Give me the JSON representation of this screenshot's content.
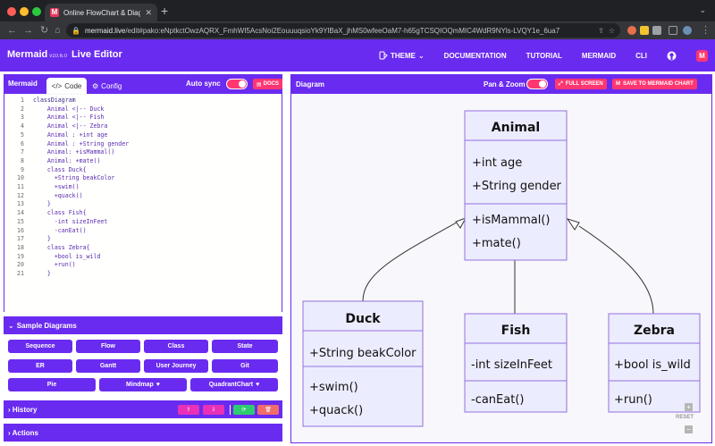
{
  "browser": {
    "tab_title": "Online FlowChart & Diagrams",
    "url_host": "mermaid.live",
    "url_path": "/edit#pako:eNptkctOwzAQRX_FmhWI5AcsNoi2EouuuqsioYk9YlBaX_jhMS0wfeeOaM7-h65gTCSQIOQmMIC4WdR9NYls-LVQY1e_6ua7",
    "colors": {
      "brand": "#6a2bf0",
      "accent": "#ff3670",
      "chrome": "#202124"
    }
  },
  "header": {
    "brand": "Mermaid",
    "version": "v10.6.0",
    "brand_suffix": "Live Editor",
    "nav": [
      "THEME",
      "DOCUMENTATION",
      "TUTORIAL",
      "MERMAID",
      "CLI"
    ]
  },
  "editor": {
    "title": "Mermaid",
    "tab_code": "Code",
    "tab_config": "Config",
    "autosync_label": "Auto sync",
    "autosync_on": true,
    "docs_label": "DOCS",
    "code_lines": [
      "classDiagram",
      "    Animal <|-- Duck",
      "    Animal <|-- Fish",
      "    Animal <|-- Zebra",
      "    Animal : +int age",
      "    Animal : +String gender",
      "    Animal: +isMammal()",
      "    Animal: +mate()",
      "    class Duck{",
      "      +String beakColor",
      "      +swim()",
      "      +quack()",
      "    }",
      "    class Fish{",
      "      -int sizeInFeet",
      "      -canEat()",
      "    }",
      "    class Zebra{",
      "      +bool is_wild",
      "      +run()",
      "    }"
    ]
  },
  "samples": {
    "title": "Sample Diagrams",
    "buttons": [
      "Sequence",
      "Flow",
      "Class",
      "State",
      "ER",
      "Gantt",
      "User Journey",
      "Git",
      "Pie",
      "Mindmap",
      "QuadrantChart"
    ]
  },
  "history": {
    "title": "History"
  },
  "actions": {
    "title": "Actions"
  },
  "diagram": {
    "title": "Diagram",
    "panzoom_label": "Pan & Zoom",
    "panzoom_on": true,
    "fullscreen_label": "FULL SCREEN",
    "save_label": "SAVE TO MERMAID CHART",
    "reset_label": "RESET",
    "classes": {
      "animal": {
        "name": "Animal",
        "attributes": [
          "+int age",
          "+String gender"
        ],
        "methods": [
          "+isMammal()",
          "+mate()"
        ]
      },
      "duck": {
        "name": "Duck",
        "attributes": [
          "+String beakColor"
        ],
        "methods": [
          "+swim()",
          "+quack()"
        ]
      },
      "fish": {
        "name": "Fish",
        "attributes": [
          "-int sizeInFeet"
        ],
        "methods": [
          "-canEat()"
        ]
      },
      "zebra": {
        "name": "Zebra",
        "attributes": [
          "+bool is_wild"
        ],
        "methods": [
          "+run()"
        ]
      }
    }
  }
}
